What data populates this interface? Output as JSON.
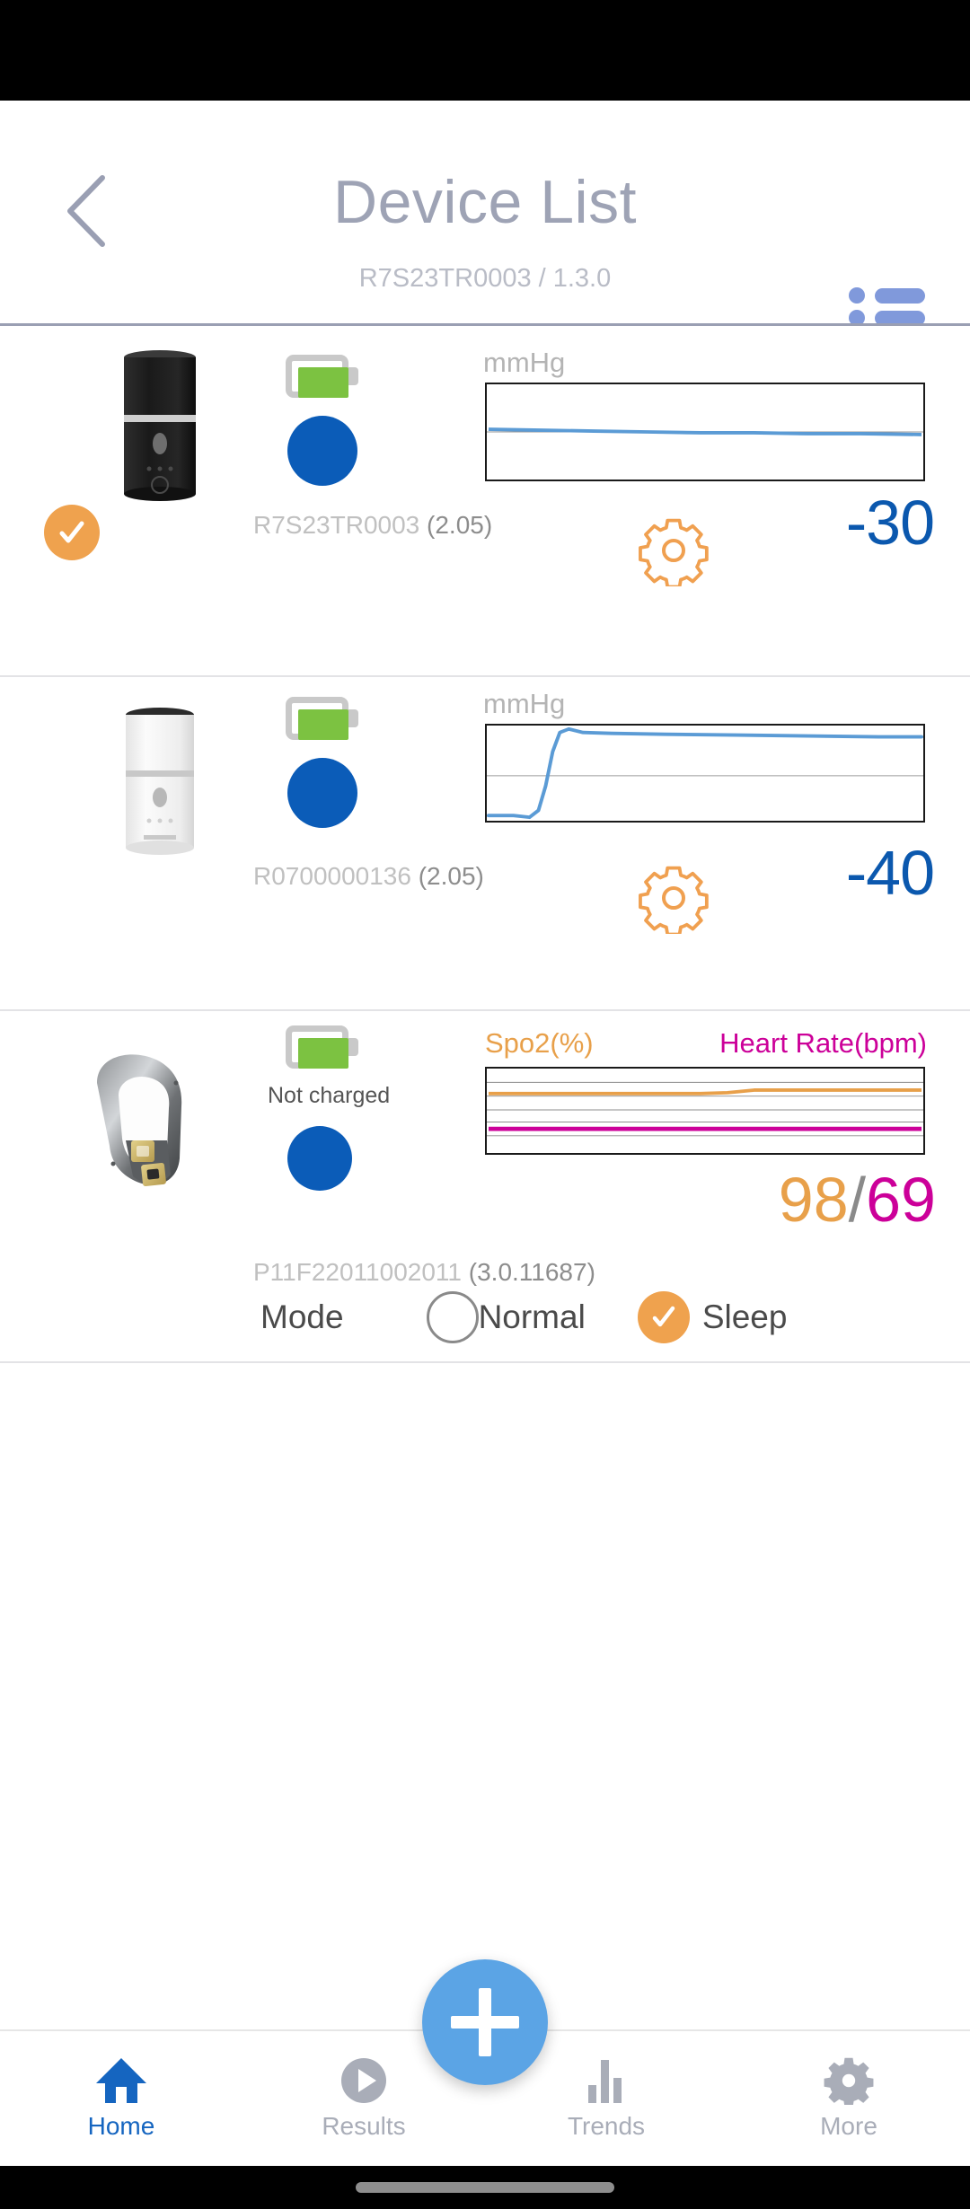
{
  "header": {
    "back_icon": "chevron-left-icon",
    "title": "Device List",
    "subtitle": "R7S23TR0003 / 1.3.0",
    "list_icon": "list-view-icon",
    "title_color": "#9ea3b5",
    "list_icon_color": "#8099db"
  },
  "devices": [
    {
      "selected": true,
      "selected_icon": "check-circle-icon",
      "thumb_icon": "black-cylinder-device-icon",
      "battery_icon": "battery-full-icon",
      "battery_note": "",
      "status_dot": "connected-dot",
      "chart_unit": "mmHg",
      "settings_icon": "gear-icon",
      "value": "-30",
      "value_color": "#0b58ae",
      "serial": "R7S23TR0003",
      "firmware": "(2.05)"
    },
    {
      "selected": false,
      "selected_icon": "check-circle-icon",
      "thumb_icon": "white-cylinder-device-icon",
      "battery_icon": "battery-full-icon",
      "battery_note": "",
      "status_dot": "connected-dot",
      "chart_unit": "mmHg",
      "settings_icon": "gear-icon",
      "value": "-40",
      "value_color": "#0b58ae",
      "serial": "R0700000136",
      "firmware": "(2.05)"
    },
    {
      "selected": false,
      "selected_icon": "check-circle-icon",
      "thumb_icon": "ring-sensor-device-icon",
      "battery_icon": "battery-full-icon",
      "battery_note": "Not charged",
      "status_dot": "connected-dot",
      "spo2_label": "Spo2(%)",
      "hr_label": "Heart Rate(bpm)",
      "spo2_value": "98",
      "value_separator": "/",
      "hr_value": "69",
      "spo2_color": "#e8a04a",
      "hr_color": "#cc0099",
      "serial": "P11F22011002011",
      "firmware": "(3.0.11687)",
      "mode": {
        "label": "Mode",
        "options": [
          {
            "label": "Normal",
            "selected": false
          },
          {
            "label": "Sleep",
            "selected": true
          }
        ]
      }
    }
  ],
  "chart_data": [
    {
      "type": "line",
      "title": "mmHg",
      "ylabel": "mmHg",
      "grid": true,
      "gridlines": 1,
      "series": [
        {
          "name": "pressure",
          "color": "#5b9bd5",
          "values": [
            -30,
            -30,
            -30,
            -30.5,
            -30.5,
            -31,
            -31,
            -31,
            -31.5,
            -31.5,
            -32,
            -32
          ]
        }
      ],
      "ylim": [
        -60,
        0
      ]
    },
    {
      "type": "line",
      "title": "mmHg",
      "ylabel": "mmHg",
      "grid": true,
      "gridlines": 1,
      "series": [
        {
          "name": "pressure",
          "color": "#5b9bd5",
          "values": [
            -78,
            -79,
            -40,
            -2,
            -1,
            -2,
            -2,
            -2,
            -2.5,
            -3,
            -3,
            -3.5
          ]
        }
      ],
      "ylim": [
        -80,
        0
      ]
    },
    {
      "type": "line",
      "title": "Spo2(%) / Heart Rate(bpm)",
      "grid": true,
      "gridlines": 6,
      "series": [
        {
          "name": "Spo2(%)",
          "color": "#e8a04a",
          "values": [
            97,
            97,
            97,
            97,
            97,
            97.2,
            98,
            98,
            98,
            98,
            98,
            98
          ]
        },
        {
          "name": "Heart Rate(bpm)",
          "color": "#cc0099",
          "values": [
            69,
            69,
            69,
            69,
            69,
            69,
            69,
            69,
            69,
            69,
            69,
            69
          ]
        }
      ]
    }
  ],
  "fab": {
    "icon": "plus-icon",
    "color": "#5ba4e5"
  },
  "bottom_nav": {
    "items": [
      {
        "label": "Home",
        "icon": "home-icon",
        "active": true
      },
      {
        "label": "Results",
        "icon": "play-circle-icon",
        "active": false
      },
      {
        "label": "Trends",
        "icon": "bar-chart-icon",
        "active": false
      },
      {
        "label": "More",
        "icon": "gear-icon",
        "active": false
      }
    ],
    "active_color": "#1565c0",
    "inactive_color": "#a9adb8"
  }
}
